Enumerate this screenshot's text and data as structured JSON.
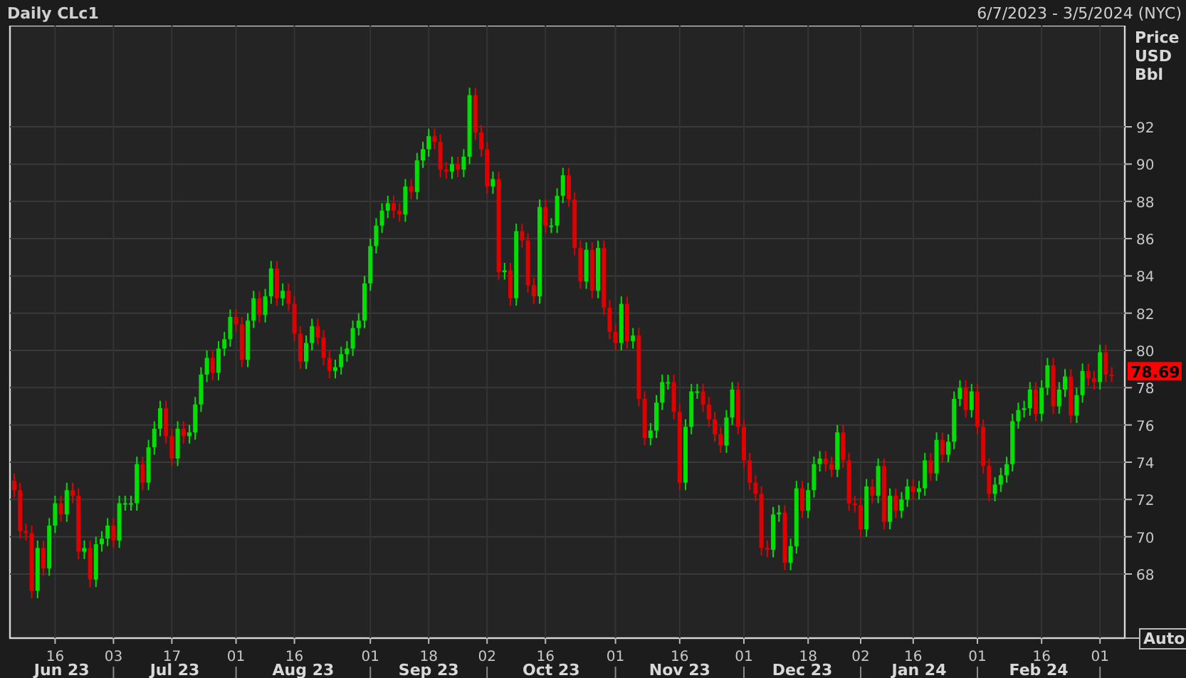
{
  "header": {
    "title": "Daily CLc1",
    "date_range": "6/7/2023 - 3/5/2024 (NYC)"
  },
  "chart": {
    "axis_title": [
      "Price",
      "USD",
      "Bbl"
    ],
    "last_price": "78.69",
    "auto_button": "Auto",
    "months": [
      "Jun 23",
      "Jul 23",
      "Aug 23",
      "Sep 23",
      "Oct 23",
      "Nov 23",
      "Dec 23",
      "Jan 24",
      "Feb 24"
    ],
    "chart_data": {
      "type": "candlestick",
      "grid": true,
      "ylim": [
        64.56,
        97.43
      ],
      "yticks": [
        68,
        70,
        72,
        74,
        76,
        78,
        80,
        82,
        84,
        86,
        88,
        90,
        92
      ],
      "categories": [
        null,
        null,
        null,
        null,
        null,
        null,
        null,
        "16",
        null,
        null,
        null,
        null,
        null,
        null,
        null,
        null,
        null,
        "03",
        null,
        null,
        null,
        null,
        null,
        null,
        null,
        null,
        null,
        "17",
        null,
        null,
        null,
        null,
        null,
        null,
        null,
        null,
        null,
        null,
        "01",
        null,
        null,
        null,
        null,
        null,
        null,
        null,
        null,
        null,
        "16",
        null,
        null,
        null,
        null,
        null,
        null,
        null,
        null,
        null,
        null,
        null,
        null,
        "01",
        null,
        null,
        null,
        null,
        null,
        null,
        null,
        null,
        null,
        "18",
        null,
        null,
        null,
        null,
        null,
        null,
        null,
        null,
        null,
        "02",
        null,
        null,
        null,
        null,
        null,
        null,
        null,
        null,
        null,
        "16",
        null,
        null,
        null,
        null,
        null,
        null,
        null,
        null,
        null,
        null,
        null,
        "01",
        null,
        null,
        null,
        null,
        null,
        null,
        null,
        null,
        null,
        null,
        "16",
        null,
        null,
        null,
        null,
        null,
        null,
        null,
        null,
        null,
        null,
        "01",
        null,
        null,
        null,
        null,
        null,
        null,
        null,
        null,
        null,
        null,
        "18",
        null,
        null,
        null,
        null,
        null,
        null,
        null,
        null,
        "02",
        null,
        null,
        null,
        null,
        null,
        null,
        null,
        null,
        "16",
        null,
        null,
        null,
        null,
        null,
        null,
        null,
        null,
        null,
        null,
        "01",
        null,
        null,
        null,
        null,
        null,
        null,
        null,
        null,
        null,
        null,
        "16",
        null,
        null,
        null,
        null,
        null,
        null,
        null,
        null,
        null,
        "01",
        null,
        null
      ],
      "ohlc": [
        [
          73.0,
          73.4,
          72.1,
          72.5
        ],
        [
          72.5,
          72.9,
          69.9,
          70.3
        ],
        [
          70.3,
          70.7,
          69.8,
          70.2
        ],
        [
          70.2,
          70.6,
          66.7,
          67.1
        ],
        [
          67.1,
          69.8,
          66.7,
          69.4
        ],
        [
          69.4,
          69.8,
          67.9,
          68.3
        ],
        [
          68.3,
          71.0,
          67.9,
          70.6
        ],
        [
          70.6,
          72.2,
          70.2,
          71.8
        ],
        [
          71.8,
          72.2,
          70.8,
          71.2
        ],
        [
          71.2,
          72.9,
          70.8,
          72.5
        ],
        [
          72.5,
          72.9,
          71.8,
          72.2
        ],
        [
          72.2,
          72.6,
          68.8,
          69.2
        ],
        [
          69.2,
          69.8,
          68.8,
          69.4
        ],
        [
          69.4,
          69.8,
          67.3,
          67.7
        ],
        [
          67.7,
          70.0,
          67.3,
          69.6
        ],
        [
          69.6,
          70.3,
          69.2,
          69.9
        ],
        [
          69.9,
          71.0,
          69.5,
          70.6
        ],
        [
          70.6,
          71.0,
          69.4,
          69.8
        ],
        [
          69.8,
          72.2,
          69.4,
          71.8
        ],
        [
          71.8,
          72.2,
          71.4,
          71.8
        ],
        [
          71.8,
          72.2,
          71.4,
          71.8
        ],
        [
          71.8,
          74.3,
          71.4,
          73.9
        ],
        [
          73.9,
          74.3,
          72.5,
          72.9
        ],
        [
          72.9,
          75.2,
          72.5,
          74.8
        ],
        [
          74.8,
          76.2,
          74.4,
          75.8
        ],
        [
          75.8,
          77.3,
          75.4,
          76.9
        ],
        [
          76.9,
          77.3,
          75.0,
          75.4
        ],
        [
          75.4,
          75.8,
          73.8,
          74.2
        ],
        [
          74.2,
          76.2,
          73.8,
          75.8
        ],
        [
          75.8,
          76.2,
          75.0,
          75.4
        ],
        [
          75.4,
          76.0,
          75.0,
          75.6
        ],
        [
          75.6,
          77.5,
          75.2,
          77.1
        ],
        [
          77.1,
          79.1,
          76.7,
          78.7
        ],
        [
          78.7,
          80.0,
          78.3,
          79.6
        ],
        [
          79.6,
          80.0,
          78.4,
          78.8
        ],
        [
          78.8,
          80.5,
          78.4,
          80.1
        ],
        [
          80.1,
          81.0,
          79.7,
          80.6
        ],
        [
          80.6,
          82.2,
          80.2,
          81.8
        ],
        [
          81.8,
          82.2,
          81.0,
          81.4
        ],
        [
          81.4,
          81.8,
          79.1,
          79.5
        ],
        [
          79.5,
          82.0,
          79.1,
          81.6
        ],
        [
          81.6,
          83.2,
          81.2,
          82.8
        ],
        [
          82.8,
          83.2,
          81.5,
          81.9
        ],
        [
          81.9,
          83.3,
          81.5,
          82.9
        ],
        [
          82.9,
          84.8,
          82.5,
          84.4
        ],
        [
          84.4,
          84.8,
          82.4,
          82.8
        ],
        [
          82.8,
          83.6,
          82.4,
          83.2
        ],
        [
          83.2,
          83.6,
          82.1,
          82.5
        ],
        [
          82.5,
          82.9,
          80.5,
          80.9
        ],
        [
          80.9,
          81.3,
          79.0,
          79.4
        ],
        [
          79.4,
          80.8,
          79.0,
          80.4
        ],
        [
          80.4,
          81.7,
          80.0,
          81.3
        ],
        [
          81.3,
          81.7,
          80.3,
          80.7
        ],
        [
          80.7,
          81.1,
          79.2,
          79.6
        ],
        [
          79.6,
          80.0,
          78.5,
          78.9
        ],
        [
          78.9,
          79.5,
          78.5,
          79.1
        ],
        [
          79.1,
          80.2,
          78.7,
          79.8
        ],
        [
          79.8,
          80.5,
          79.4,
          80.1
        ],
        [
          80.1,
          81.6,
          79.7,
          81.2
        ],
        [
          81.2,
          82.0,
          80.8,
          81.6
        ],
        [
          81.6,
          84.0,
          81.2,
          83.6
        ],
        [
          83.6,
          86.0,
          83.2,
          85.6
        ],
        [
          85.6,
          87.1,
          85.2,
          86.7
        ],
        [
          86.7,
          87.9,
          86.3,
          87.5
        ],
        [
          87.5,
          88.3,
          87.1,
          87.9
        ],
        [
          87.9,
          88.3,
          87.1,
          87.5
        ],
        [
          87.5,
          87.9,
          86.9,
          87.3
        ],
        [
          87.3,
          89.2,
          86.9,
          88.8
        ],
        [
          88.8,
          89.2,
          88.1,
          88.5
        ],
        [
          88.5,
          90.6,
          88.1,
          90.2
        ],
        [
          90.2,
          91.2,
          89.8,
          90.8
        ],
        [
          90.8,
          91.9,
          90.4,
          91.5
        ],
        [
          91.5,
          91.9,
          90.8,
          91.2
        ],
        [
          91.2,
          91.6,
          89.3,
          89.7
        ],
        [
          89.7,
          90.1,
          89.2,
          89.6
        ],
        [
          89.6,
          90.4,
          89.2,
          90.0
        ],
        [
          90.0,
          90.4,
          89.3,
          89.7
        ],
        [
          89.7,
          90.8,
          89.3,
          90.4
        ],
        [
          90.4,
          94.1,
          90.0,
          93.7
        ],
        [
          93.7,
          94.1,
          91.3,
          91.7
        ],
        [
          91.7,
          92.1,
          90.4,
          90.8
        ],
        [
          90.8,
          91.2,
          88.4,
          88.8
        ],
        [
          88.8,
          89.6,
          88.4,
          89.2
        ],
        [
          89.2,
          89.6,
          83.8,
          84.2
        ],
        [
          84.2,
          84.7,
          83.8,
          84.3
        ],
        [
          84.3,
          84.7,
          82.4,
          82.8
        ],
        [
          82.8,
          86.8,
          82.4,
          86.4
        ],
        [
          86.4,
          86.8,
          85.5,
          85.9
        ],
        [
          85.9,
          86.3,
          83.1,
          83.5
        ],
        [
          83.5,
          83.9,
          82.5,
          82.9
        ],
        [
          82.9,
          88.1,
          82.5,
          87.7
        ],
        [
          87.7,
          88.1,
          86.3,
          86.7
        ],
        [
          86.7,
          87.1,
          86.3,
          86.7
        ],
        [
          86.7,
          88.7,
          86.3,
          88.3
        ],
        [
          88.3,
          89.8,
          87.9,
          89.4
        ],
        [
          89.4,
          89.8,
          87.7,
          88.1
        ],
        [
          88.1,
          88.5,
          85.1,
          85.5
        ],
        [
          85.5,
          85.9,
          83.3,
          83.7
        ],
        [
          83.7,
          85.8,
          83.3,
          85.4
        ],
        [
          85.4,
          85.8,
          82.8,
          83.2
        ],
        [
          83.2,
          85.9,
          82.8,
          85.5
        ],
        [
          85.5,
          85.9,
          81.9,
          82.3
        ],
        [
          82.3,
          82.7,
          80.6,
          81.0
        ],
        [
          81.0,
          81.4,
          80.0,
          80.4
        ],
        [
          80.4,
          82.9,
          80.0,
          82.5
        ],
        [
          82.5,
          82.9,
          80.1,
          80.5
        ],
        [
          80.5,
          81.2,
          80.1,
          80.8
        ],
        [
          80.8,
          81.2,
          77.0,
          77.4
        ],
        [
          77.4,
          77.8,
          74.9,
          75.3
        ],
        [
          75.3,
          76.1,
          74.9,
          75.7
        ],
        [
          75.7,
          77.6,
          75.3,
          77.2
        ],
        [
          77.2,
          78.7,
          76.8,
          78.3
        ],
        [
          78.3,
          78.7,
          77.9,
          78.3
        ],
        [
          78.3,
          78.7,
          76.3,
          76.7
        ],
        [
          76.7,
          77.1,
          72.5,
          72.9
        ],
        [
          72.9,
          76.3,
          72.5,
          75.9
        ],
        [
          75.9,
          78.2,
          75.5,
          77.8
        ],
        [
          77.8,
          78.2,
          77.4,
          77.8
        ],
        [
          77.8,
          78.2,
          76.7,
          77.1
        ],
        [
          77.1,
          77.5,
          75.9,
          76.3
        ],
        [
          76.3,
          76.7,
          75.1,
          75.5
        ],
        [
          75.5,
          75.9,
          74.5,
          74.9
        ],
        [
          74.9,
          76.8,
          74.5,
          76.4
        ],
        [
          76.4,
          78.3,
          76.0,
          77.9
        ],
        [
          77.9,
          78.3,
          75.5,
          75.9
        ],
        [
          75.9,
          76.3,
          73.7,
          74.1
        ],
        [
          74.1,
          74.5,
          72.5,
          72.9
        ],
        [
          72.9,
          73.3,
          71.9,
          72.3
        ],
        [
          72.3,
          72.7,
          69.0,
          69.4
        ],
        [
          69.4,
          69.8,
          68.9,
          69.3
        ],
        [
          69.3,
          71.6,
          68.9,
          71.2
        ],
        [
          71.2,
          71.7,
          70.8,
          71.3
        ],
        [
          71.3,
          71.7,
          68.2,
          68.6
        ],
        [
          68.6,
          69.9,
          68.2,
          69.5
        ],
        [
          69.5,
          73.0,
          69.1,
          72.6
        ],
        [
          72.6,
          73.0,
          71.0,
          71.4
        ],
        [
          71.4,
          72.9,
          71.0,
          72.5
        ],
        [
          72.5,
          74.3,
          72.1,
          73.9
        ],
        [
          73.9,
          74.6,
          73.5,
          74.2
        ],
        [
          74.2,
          74.6,
          73.5,
          73.9
        ],
        [
          73.9,
          74.3,
          73.2,
          73.6
        ],
        [
          73.6,
          76.0,
          73.2,
          75.6
        ],
        [
          75.6,
          76.0,
          73.7,
          74.1
        ],
        [
          74.1,
          74.5,
          71.4,
          71.8
        ],
        [
          71.8,
          72.2,
          71.3,
          71.7
        ],
        [
          71.7,
          72.1,
          70.0,
          70.4
        ],
        [
          70.4,
          73.1,
          70.0,
          72.7
        ],
        [
          72.7,
          73.1,
          71.8,
          72.2
        ],
        [
          72.2,
          74.2,
          71.8,
          73.8
        ],
        [
          73.8,
          74.2,
          70.4,
          70.8
        ],
        [
          70.8,
          72.6,
          70.4,
          72.2
        ],
        [
          72.2,
          72.6,
          71.0,
          71.4
        ],
        [
          71.4,
          72.4,
          71.0,
          72.0
        ],
        [
          72.0,
          73.1,
          71.6,
          72.7
        ],
        [
          72.7,
          73.1,
          72.0,
          72.4
        ],
        [
          72.4,
          73.0,
          72.0,
          72.6
        ],
        [
          72.6,
          74.5,
          72.2,
          74.1
        ],
        [
          74.1,
          74.5,
          73.0,
          73.4
        ],
        [
          73.4,
          75.6,
          73.0,
          75.2
        ],
        [
          75.2,
          75.6,
          74.0,
          74.4
        ],
        [
          74.4,
          75.5,
          74.0,
          75.1
        ],
        [
          75.1,
          77.8,
          74.7,
          77.4
        ],
        [
          77.4,
          78.4,
          77.0,
          78.0
        ],
        [
          78.0,
          78.4,
          76.4,
          76.8
        ],
        [
          76.8,
          78.2,
          76.4,
          77.8
        ],
        [
          77.8,
          78.2,
          75.5,
          75.9
        ],
        [
          75.9,
          76.3,
          73.4,
          73.8
        ],
        [
          73.8,
          74.2,
          71.9,
          72.3
        ],
        [
          72.3,
          73.2,
          71.9,
          72.8
        ],
        [
          72.8,
          73.7,
          72.4,
          73.3
        ],
        [
          73.3,
          74.3,
          72.9,
          73.9
        ],
        [
          73.9,
          76.6,
          73.5,
          76.2
        ],
        [
          76.2,
          77.2,
          75.8,
          76.8
        ],
        [
          76.8,
          77.3,
          76.4,
          76.9
        ],
        [
          76.9,
          78.3,
          76.5,
          77.9
        ],
        [
          77.9,
          78.3,
          76.2,
          76.6
        ],
        [
          76.6,
          78.4,
          76.2,
          78.0
        ],
        [
          78.0,
          79.6,
          77.6,
          79.2
        ],
        [
          79.2,
          79.6,
          76.6,
          77.0
        ],
        [
          77.0,
          78.3,
          76.6,
          77.9
        ],
        [
          77.9,
          79.0,
          77.5,
          78.6
        ],
        [
          78.6,
          79.0,
          76.1,
          76.5
        ],
        [
          76.5,
          78.0,
          76.1,
          77.6
        ],
        [
          77.6,
          79.3,
          77.2,
          78.9
        ],
        [
          78.9,
          79.3,
          78.1,
          78.5
        ],
        [
          78.5,
          78.9,
          77.9,
          78.3
        ],
        [
          78.3,
          80.3,
          77.9,
          79.9
        ],
        [
          79.9,
          80.3,
          78.3,
          78.7
        ],
        [
          78.7,
          79.1,
          78.3,
          78.69
        ]
      ]
    }
  }
}
